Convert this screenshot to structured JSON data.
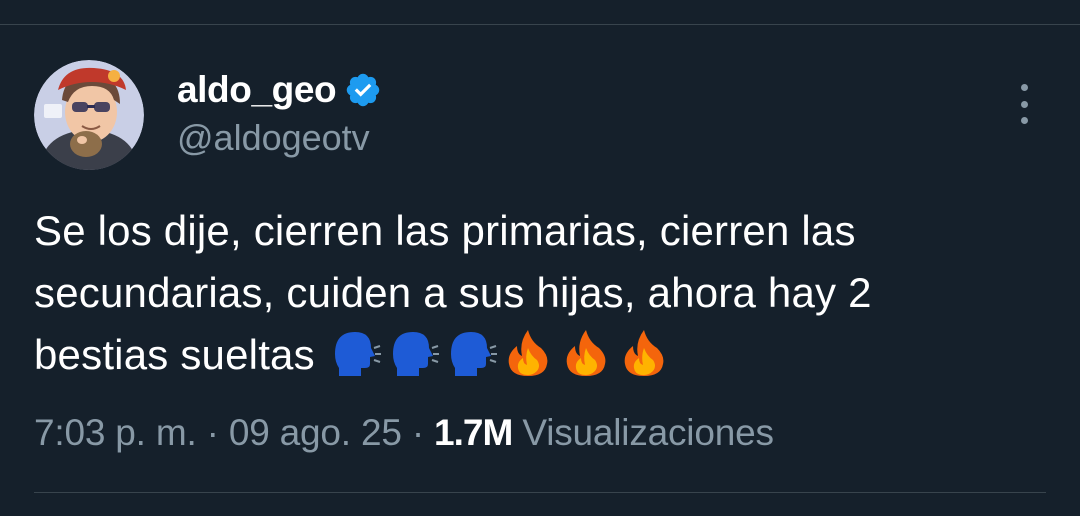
{
  "tweet": {
    "author": {
      "display_name": "aldo_geo",
      "handle": "@aldogeotv",
      "verified": true,
      "verified_color": "#1d9bf0"
    },
    "text_line1": "Se los dije, cierren las primarias, cierren las",
    "text_line2": "secundarias, cuiden a sus hijas, ahora hay 2",
    "text_line3": "bestias sueltas",
    "emojis": [
      "speaking-head-icon",
      "speaking-head-icon",
      "speaking-head-icon",
      "fire-icon",
      "fire-icon",
      "fire-icon"
    ],
    "time": "7:03 p. m.",
    "separator": "·",
    "date": "09 ago. 25",
    "views_count": "1.7M",
    "views_label": "Visualizaciones"
  },
  "colors": {
    "background": "#15202b",
    "text_primary": "#ffffff",
    "text_secondary": "#8899a6",
    "divider": "#38444d"
  }
}
